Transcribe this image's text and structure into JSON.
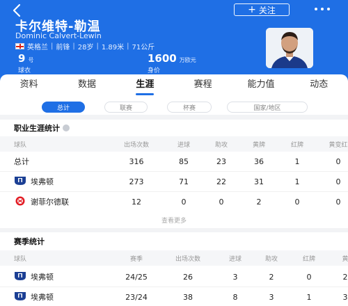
{
  "header": {
    "follow_label": "关注",
    "name_cn": "卡尔维特-勒温",
    "name_en": "Dominic Calvert-Lewin",
    "country": "英格兰",
    "position": "前锋",
    "age": "28岁",
    "height": "1.89米",
    "weight": "71公斤",
    "jersey_number": "9",
    "jersey_unit": "号",
    "jersey_label": "球衣",
    "value": "1600",
    "value_unit": "万欧元",
    "value_label": "身价",
    "accent_color": "#1f6fe5"
  },
  "tabs": [
    "资料",
    "数据",
    "生涯",
    "赛程",
    "能力值",
    "动态"
  ],
  "active_tab": "生涯",
  "filters": [
    "总计",
    "联赛",
    "杯赛",
    "国家/地区"
  ],
  "active_filter": "总计",
  "career": {
    "title": "职业生涯统计",
    "columns": [
      "球队",
      "出场次数",
      "进球",
      "助攻",
      "黄牌",
      "红牌",
      "黄变红"
    ],
    "rows": [
      {
        "team": "总计",
        "apps": "316",
        "goals": "85",
        "assists": "23",
        "yellow": "36",
        "red": "1",
        "yr": "0"
      },
      {
        "team": "埃弗顿",
        "apps": "273",
        "goals": "71",
        "assists": "22",
        "yellow": "31",
        "red": "1",
        "yr": "0"
      },
      {
        "team": "谢菲尔德联",
        "apps": "12",
        "goals": "0",
        "assists": "0",
        "yellow": "2",
        "red": "0",
        "yr": "0"
      }
    ],
    "see_more": "查看更多"
  },
  "season": {
    "title": "赛季统计",
    "columns": [
      "球队",
      "赛季",
      "出场次数",
      "进球",
      "助攻",
      "红牌",
      "黄"
    ],
    "rows": [
      {
        "team": "埃弗顿",
        "season": "24/25",
        "apps": "26",
        "goals": "3",
        "assists": "2",
        "red": "0",
        "yellow": "2"
      },
      {
        "team": "埃弗顿",
        "season": "23/24",
        "apps": "38",
        "goals": "8",
        "assists": "3",
        "red": "1",
        "yellow": "3"
      }
    ]
  }
}
